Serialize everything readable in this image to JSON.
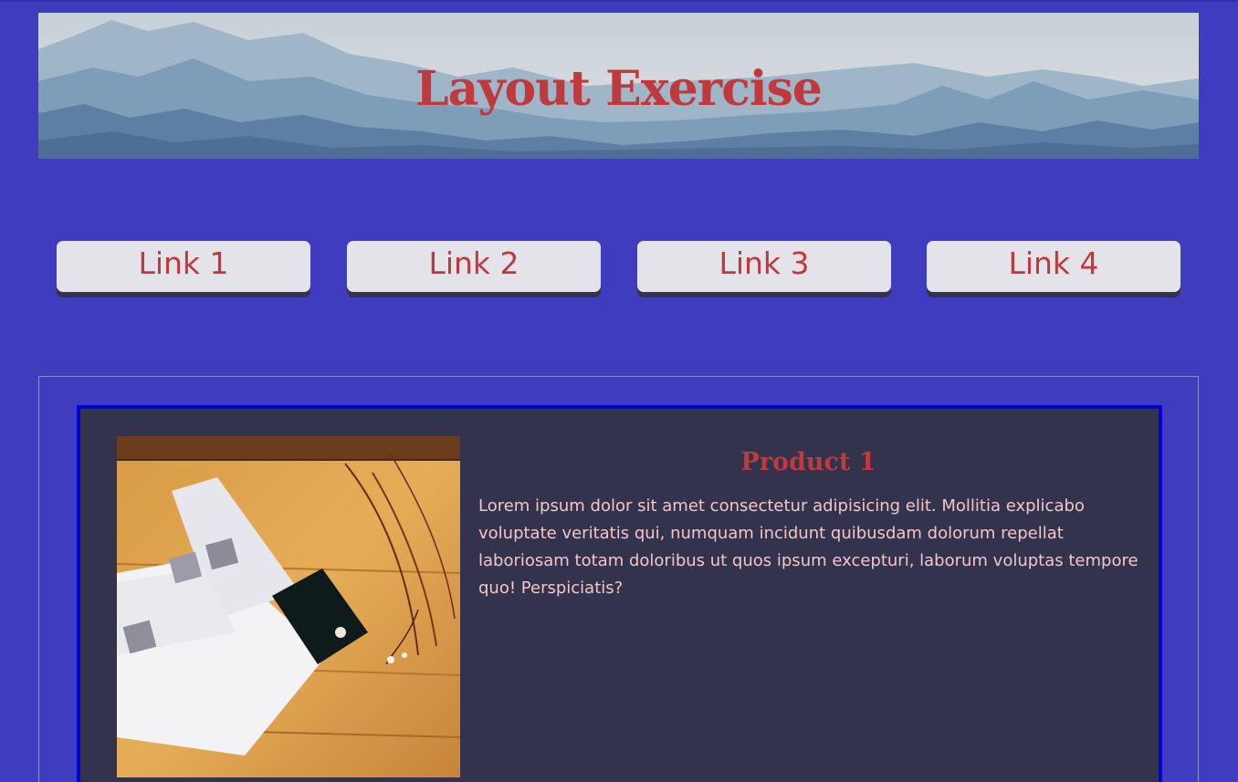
{
  "header": {
    "title": "Layout Exercise"
  },
  "nav": {
    "links": [
      {
        "label": "Link 1"
      },
      {
        "label": "Link 2"
      },
      {
        "label": "Link 3"
      },
      {
        "label": "Link 4"
      }
    ]
  },
  "products": [
    {
      "title": "Product 1",
      "description": "Lorem ipsum dolor sit amet consectetur adipisicing elit. Mollitia explicabo voluptate veritatis qui, numquam incidunt quibusdam dolorum repellat laboriosam totam doloribus ut quos ipsum excepturi, laborum voluptas tempore quo! Perspiciatis?"
    }
  ],
  "colors": {
    "page_background": "#403cc0",
    "accent_text": "#c0393c",
    "nav_button_bg": "#e4e3ea",
    "card_bg": "#34334e",
    "card_border": "#0000d8",
    "body_text": "#f2c6c6"
  }
}
